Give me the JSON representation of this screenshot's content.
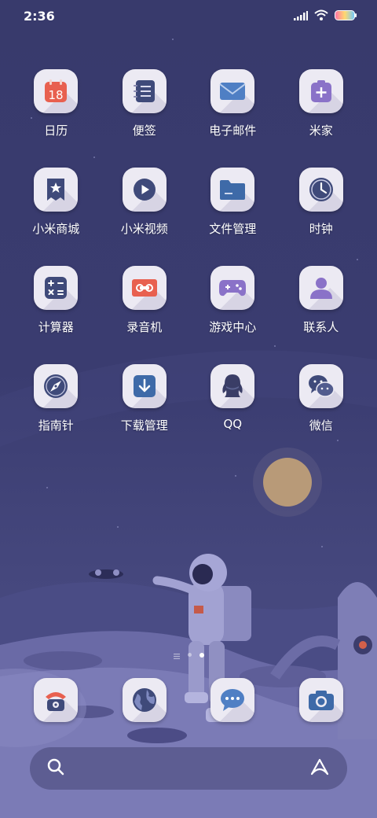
{
  "status_bar": {
    "time": "2:36"
  },
  "apps": [
    {
      "label": "日历",
      "icon": "calendar-icon",
      "day": "18"
    },
    {
      "label": "便签",
      "icon": "notes-icon"
    },
    {
      "label": "电子邮件",
      "icon": "mail-icon"
    },
    {
      "label": "米家",
      "icon": "mijia-icon"
    },
    {
      "label": "小米商城",
      "icon": "store-icon"
    },
    {
      "label": "小米视频",
      "icon": "video-icon"
    },
    {
      "label": "文件管理",
      "icon": "folder-icon"
    },
    {
      "label": "时钟",
      "icon": "clock-icon"
    },
    {
      "label": "计算器",
      "icon": "calculator-icon"
    },
    {
      "label": "录音机",
      "icon": "recorder-icon"
    },
    {
      "label": "游戏中心",
      "icon": "gamepad-icon"
    },
    {
      "label": "联系人",
      "icon": "contacts-icon"
    },
    {
      "label": "指南针",
      "icon": "compass-icon"
    },
    {
      "label": "下载管理",
      "icon": "download-icon"
    },
    {
      "label": "QQ",
      "icon": "qq-icon"
    },
    {
      "label": "微信",
      "icon": "wechat-icon"
    }
  ],
  "dock": [
    {
      "icon": "phone-icon"
    },
    {
      "icon": "browser-icon"
    },
    {
      "icon": "messages-icon"
    },
    {
      "icon": "camera-icon"
    }
  ],
  "page_indicator": {
    "pages": 2,
    "current": 2
  },
  "colors": {
    "background": "#3a3b6e",
    "tile": "#eceaf3",
    "accent_red": "#e8604f",
    "accent_navy": "#3f4a7a",
    "accent_purple": "#8a72c8"
  }
}
